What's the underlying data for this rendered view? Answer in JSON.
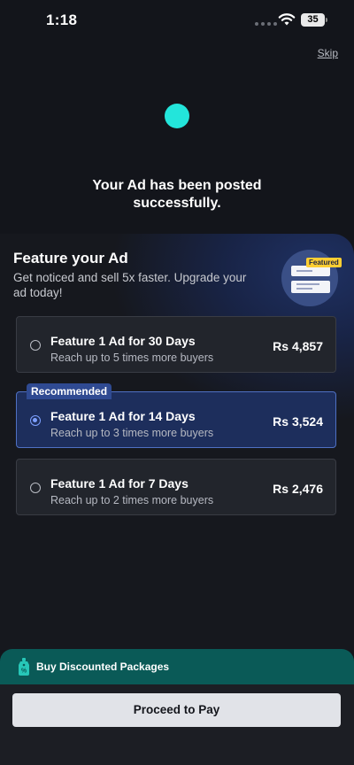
{
  "status_bar": {
    "time": "1:18",
    "battery": "35",
    "icons": [
      "signal-dots-icon",
      "wifi-icon",
      "battery-icon"
    ]
  },
  "header": {
    "skip_label": "Skip"
  },
  "success": {
    "message": "Your Ad has been posted successfully."
  },
  "feature": {
    "title": "Feature your Ad",
    "subtitle": "Get noticed and sell 5x faster. Upgrade your ad today!",
    "badge": "Featured",
    "recommended_label": "Recommended",
    "options": [
      {
        "title": "Feature 1 Ad for 30 Days",
        "subtitle": "Reach up to 5 times more buyers",
        "price": "Rs 4,857",
        "selected": false
      },
      {
        "title": "Feature 1 Ad for 14 Days",
        "subtitle": "Reach up to 3 times more buyers",
        "price": "Rs 3,524",
        "selected": true
      },
      {
        "title": "Feature 1 Ad for 7 Days",
        "subtitle": "Reach up to 2 times more buyers",
        "price": "Rs 2,476",
        "selected": false
      }
    ]
  },
  "packages": {
    "label": "Buy Discounted Packages",
    "icon": "price-tag-icon"
  },
  "cta": {
    "label": "Proceed to Pay"
  },
  "colors": {
    "background": "#13151b",
    "accent_teal": "#23e5db",
    "selected_blue": "#1d2e5c",
    "packages_bar": "#0a5a57",
    "badge_yellow": "#ffce32"
  }
}
